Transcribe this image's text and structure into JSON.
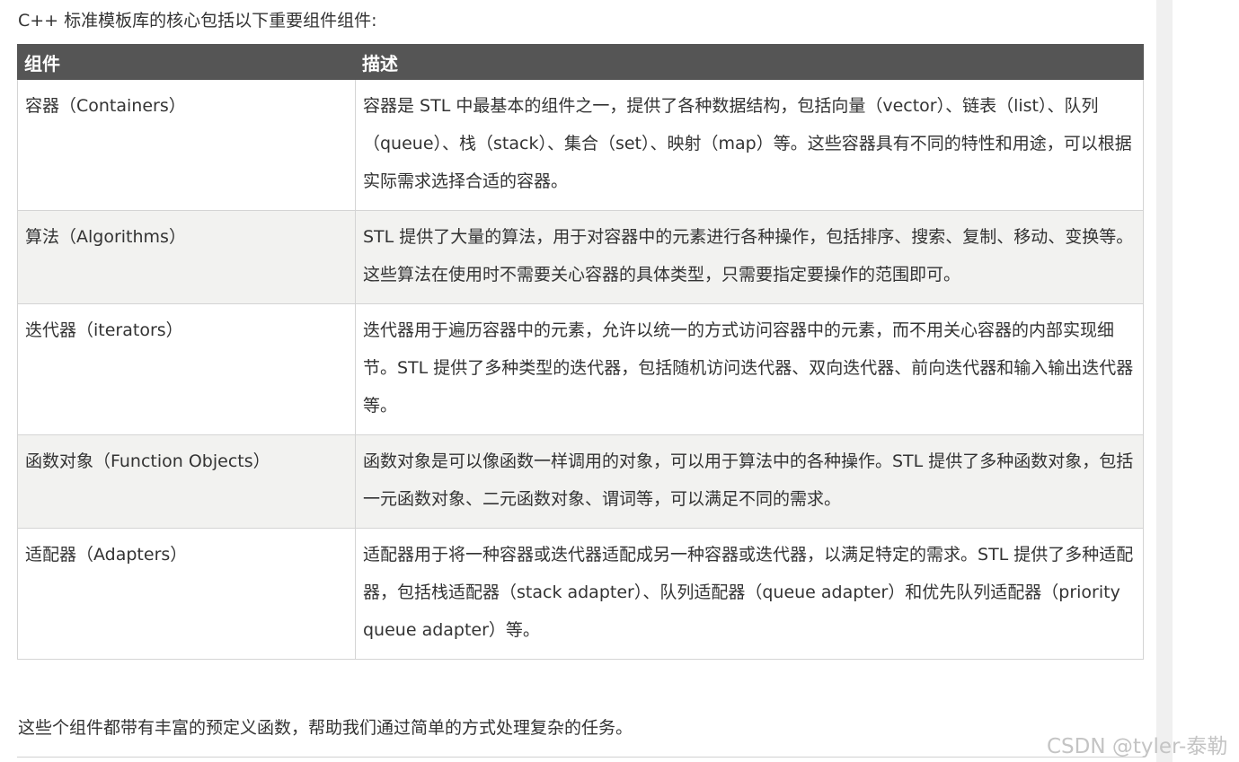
{
  "intro_text": "C++ 标准模板库的核心包括以下重要组件组件:",
  "table": {
    "headers": [
      "组件",
      "描述"
    ],
    "rows": [
      {
        "name": "容器（Containers）",
        "description": "容器是 STL 中最基本的组件之一，提供了各种数据结构，包括向量（vector）、链表（list）、队列（queue）、栈（stack）、集合（set）、映射（map）等。这些容器具有不同的特性和用途，可以根据实际需求选择合适的容器。"
      },
      {
        "name": "算法（Algorithms）",
        "description": "STL 提供了大量的算法，用于对容器中的元素进行各种操作，包括排序、搜索、复制、移动、变换等。这些算法在使用时不需要关心容器的具体类型，只需要指定要操作的范围即可。"
      },
      {
        "name": "迭代器（iterators）",
        "description": "迭代器用于遍历容器中的元素，允许以统一的方式访问容器中的元素，而不用关心容器的内部实现细节。STL 提供了多种类型的迭代器，包括随机访问迭代器、双向迭代器、前向迭代器和输入输出迭代器等。"
      },
      {
        "name": "函数对象（Function Objects）",
        "description": "函数对象是可以像函数一样调用的对象，可以用于算法中的各种操作。STL 提供了多种函数对象，包括一元函数对象、二元函数对象、谓词等，可以满足不同的需求。"
      },
      {
        "name": "适配器（Adapters）",
        "description": "适配器用于将一种容器或迭代器适配成另一种容器或迭代器，以满足特定的需求。STL 提供了多种适配器，包括栈适配器（stack adapter）、队列适配器（queue adapter）和优先队列适配器（priority queue adapter）等。"
      }
    ]
  },
  "outro_text": "这些个组件都带有丰富的预定义函数，帮助我们通过简单的方式处理复杂的任务。",
  "watermark": "CSDN @tyler-泰勒",
  "colors": {
    "header_bg": "#555555",
    "header_text": "#ffffff",
    "row_alt_bg": "#f2f2f0",
    "border": "#d4d4d4",
    "text": "#333333"
  }
}
